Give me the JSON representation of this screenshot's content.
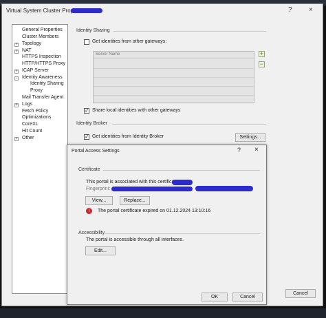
{
  "main": {
    "title": "Virtual System Cluster Properties",
    "help_icon": "?",
    "close_icon": "×",
    "footer_cancel": "Cancel"
  },
  "tree": {
    "items": [
      "General Properties",
      "Cluster Members",
      "Topology",
      "NAT",
      "HTTPS Inspection",
      "HTTP/HTTPS Proxy",
      "ICAP Server",
      "Identity Awareness",
      "Identity Sharing",
      "Proxy",
      "Mail Transfer Agent",
      "Logs",
      "Fetch Policy",
      "Optimizations",
      "CoreXL",
      "Hit Count",
      "Other"
    ]
  },
  "identity_sharing": {
    "section_label": "Identity Sharing",
    "get_identities_label": "Get identities from other gateways:",
    "get_identities_checked": false,
    "list_header": "Server Name",
    "share_label": "Share local identities with other gateways",
    "share_checked": true,
    "add_icon": "+",
    "remove_icon": "−"
  },
  "identity_broker": {
    "section_label": "Identity Broker",
    "get_identities_label": "Get identities from Identity Broker",
    "checked": true,
    "settings_button": "Settings..."
  },
  "portal_dialog": {
    "title": "Portal Access Settings",
    "help_icon": "?",
    "close_icon": "×",
    "certificate_section": "Certificate",
    "cert_text": "This portal is associated with this certificate:",
    "fingerprint_label": "Fingerprint:",
    "view_button": "View...",
    "replace_button": "Replace...",
    "error_icon": "!",
    "expired_text": "The portal certificate expired on 01.12.2024 13:10:16",
    "accessibility_section": "Accessibility",
    "access_text": "The portal is accessible through all interfaces.",
    "edit_button": "Edit...",
    "ok_button": "OK",
    "cancel_button": "Cancel"
  },
  "colors": {
    "redaction": "#2d2bc9",
    "error": "#c8292c",
    "dialog_bg": "#f0f0f0"
  }
}
